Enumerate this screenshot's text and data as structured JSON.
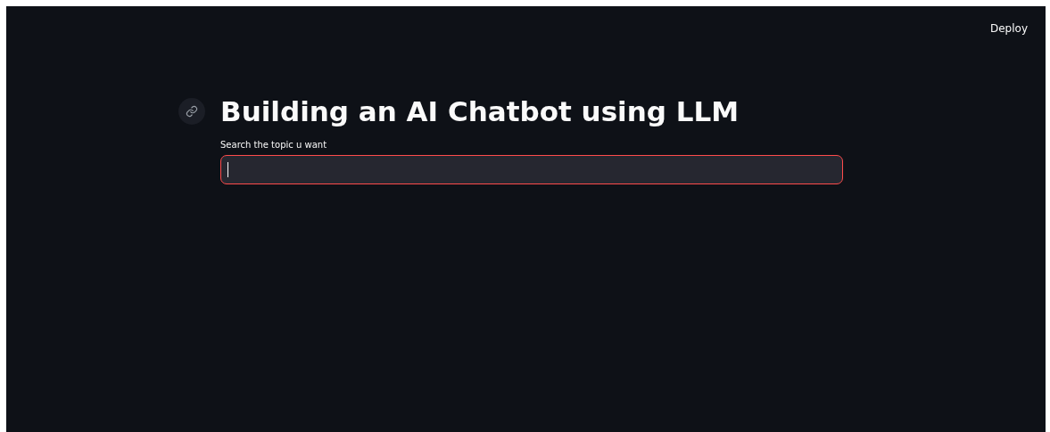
{
  "header": {
    "deploy_button": "Deploy"
  },
  "title": "Building an AI Chatbot using LLM",
  "search": {
    "label": "Search the topic u want",
    "focused": true
  }
}
